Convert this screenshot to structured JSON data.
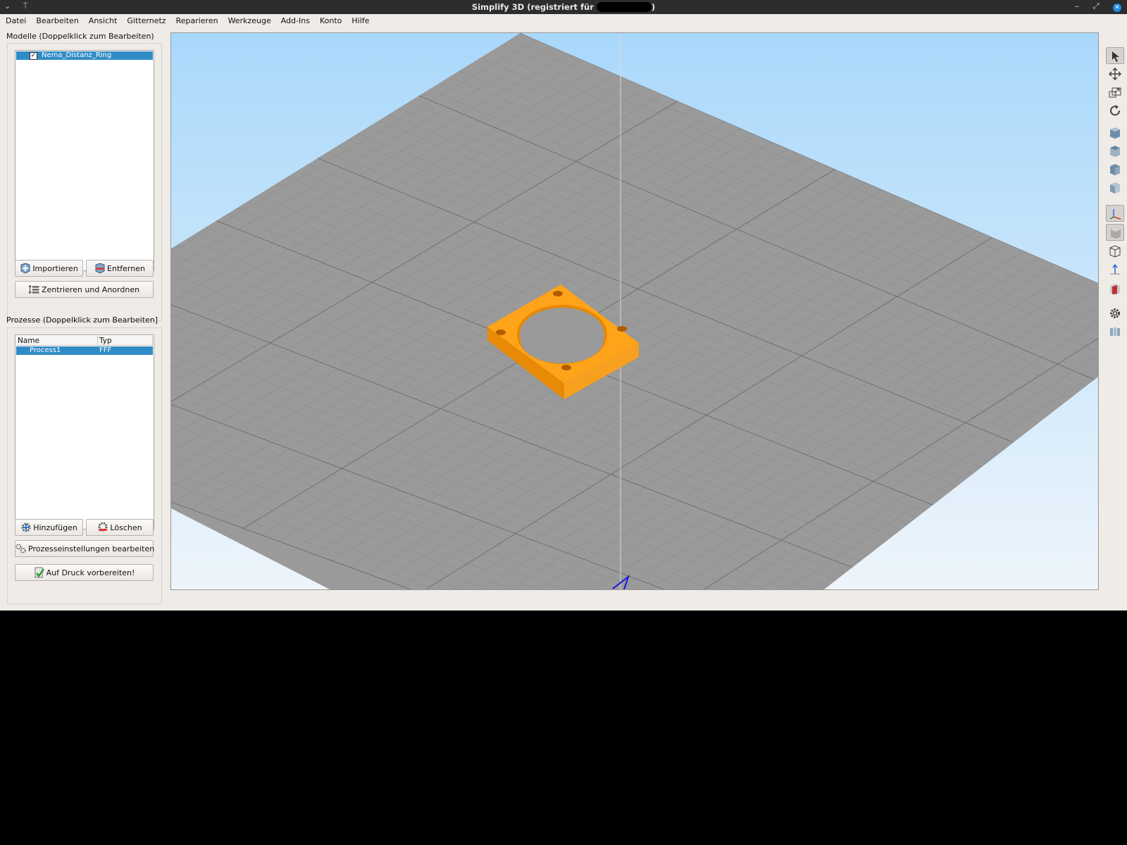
{
  "window": {
    "title": "Simplify 3D (registriert für",
    "title_end": ")",
    "controls_left": [
      "⌄",
      "⍑"
    ],
    "controls_right": [
      "‒",
      "⤢",
      "✕"
    ]
  },
  "menu": [
    "Datei",
    "Bearbeiten",
    "Ansicht",
    "Gitternetz",
    "Reparieren",
    "Werkzeuge",
    "Add-Ins",
    "Konto",
    "Hilfe"
  ],
  "models": {
    "label": "Modelle (Doppelklick zum Bearbeiten)",
    "items": [
      {
        "name": "Nema_Distanz_Ring",
        "checked": true,
        "check_mark": "✓"
      }
    ],
    "import_label": "Importieren",
    "remove_label": "Entfernen",
    "center_label": "Zentrieren und Anordnen"
  },
  "processes": {
    "label": "Prozesse (Doppelklick zum Bearbeiten]",
    "columns": [
      "Name",
      "Typ"
    ],
    "rows": [
      {
        "name": "Process1",
        "type": "FFF"
      }
    ],
    "add_label": "Hinzufügen",
    "delete_label": "Löschen",
    "edit_label": "Prozesseinstellungen bearbeiten",
    "prepare_label": "Auf Druck vorbereiten!"
  },
  "viewport": {
    "sky_color": "#a9d8fb",
    "bed_color": "#9a9a9a",
    "grid_color": "#8a8a8a",
    "model_color": "#ffa31a",
    "axis_color": "#1515e0"
  },
  "toolbar": {
    "tools": [
      "select-tool",
      "move-tool",
      "scale-tool",
      "rotate-tool",
      "view-front",
      "view-top",
      "view-side",
      "view-iso",
      "toggle-axes",
      "solid-view",
      "wireframe-view",
      "show-normals",
      "section-view",
      "settings-gear",
      "machine-view"
    ]
  }
}
